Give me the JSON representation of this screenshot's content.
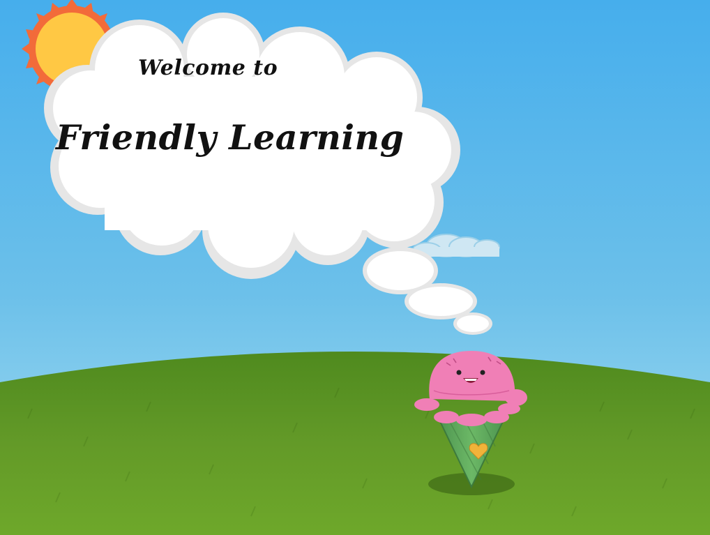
{
  "welcome": {
    "line1": "Welcome to",
    "line2": "Friendly Learning"
  },
  "colors": {
    "sky_top": "#4ab0ec",
    "sky_bottom": "#a9dff0",
    "grass": "#5c9224",
    "sun": "#ffc844",
    "sun_rays": "#f26b3a",
    "cloud": "#ffffff",
    "icecream_scoop": "#f07fb6",
    "icecream_cone": "#5aa45a",
    "heart": "#f0b33a"
  },
  "icons": {
    "sun": "sun-icon",
    "thought_cloud": "thought-cloud-icon",
    "mascot": "ice-cream-mascot-icon"
  }
}
